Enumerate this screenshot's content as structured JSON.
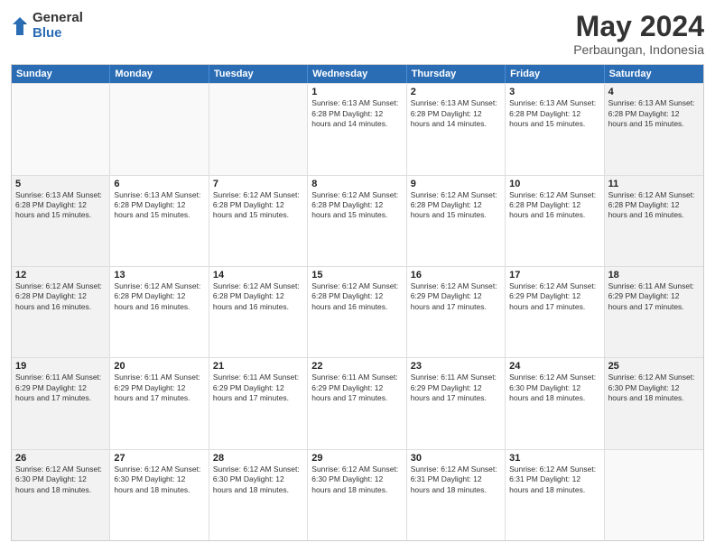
{
  "logo": {
    "general": "General",
    "blue": "Blue"
  },
  "title": "May 2024",
  "subtitle": "Perbaungan, Indonesia",
  "days": [
    "Sunday",
    "Monday",
    "Tuesday",
    "Wednesday",
    "Thursday",
    "Friday",
    "Saturday"
  ],
  "weeks": [
    [
      {
        "day": "",
        "text": "",
        "empty": true
      },
      {
        "day": "",
        "text": "",
        "empty": true
      },
      {
        "day": "",
        "text": "",
        "empty": true
      },
      {
        "day": "1",
        "text": "Sunrise: 6:13 AM\nSunset: 6:28 PM\nDaylight: 12 hours\nand 14 minutes.",
        "empty": false
      },
      {
        "day": "2",
        "text": "Sunrise: 6:13 AM\nSunset: 6:28 PM\nDaylight: 12 hours\nand 14 minutes.",
        "empty": false
      },
      {
        "day": "3",
        "text": "Sunrise: 6:13 AM\nSunset: 6:28 PM\nDaylight: 12 hours\nand 15 minutes.",
        "empty": false
      },
      {
        "day": "4",
        "text": "Sunrise: 6:13 AM\nSunset: 6:28 PM\nDaylight: 12 hours\nand 15 minutes.",
        "empty": false
      }
    ],
    [
      {
        "day": "5",
        "text": "Sunrise: 6:13 AM\nSunset: 6:28 PM\nDaylight: 12 hours\nand 15 minutes.",
        "empty": false
      },
      {
        "day": "6",
        "text": "Sunrise: 6:13 AM\nSunset: 6:28 PM\nDaylight: 12 hours\nand 15 minutes.",
        "empty": false
      },
      {
        "day": "7",
        "text": "Sunrise: 6:12 AM\nSunset: 6:28 PM\nDaylight: 12 hours\nand 15 minutes.",
        "empty": false
      },
      {
        "day": "8",
        "text": "Sunrise: 6:12 AM\nSunset: 6:28 PM\nDaylight: 12 hours\nand 15 minutes.",
        "empty": false
      },
      {
        "day": "9",
        "text": "Sunrise: 6:12 AM\nSunset: 6:28 PM\nDaylight: 12 hours\nand 15 minutes.",
        "empty": false
      },
      {
        "day": "10",
        "text": "Sunrise: 6:12 AM\nSunset: 6:28 PM\nDaylight: 12 hours\nand 16 minutes.",
        "empty": false
      },
      {
        "day": "11",
        "text": "Sunrise: 6:12 AM\nSunset: 6:28 PM\nDaylight: 12 hours\nand 16 minutes.",
        "empty": false
      }
    ],
    [
      {
        "day": "12",
        "text": "Sunrise: 6:12 AM\nSunset: 6:28 PM\nDaylight: 12 hours\nand 16 minutes.",
        "empty": false
      },
      {
        "day": "13",
        "text": "Sunrise: 6:12 AM\nSunset: 6:28 PM\nDaylight: 12 hours\nand 16 minutes.",
        "empty": false
      },
      {
        "day": "14",
        "text": "Sunrise: 6:12 AM\nSunset: 6:28 PM\nDaylight: 12 hours\nand 16 minutes.",
        "empty": false
      },
      {
        "day": "15",
        "text": "Sunrise: 6:12 AM\nSunset: 6:28 PM\nDaylight: 12 hours\nand 16 minutes.",
        "empty": false
      },
      {
        "day": "16",
        "text": "Sunrise: 6:12 AM\nSunset: 6:29 PM\nDaylight: 12 hours\nand 17 minutes.",
        "empty": false
      },
      {
        "day": "17",
        "text": "Sunrise: 6:12 AM\nSunset: 6:29 PM\nDaylight: 12 hours\nand 17 minutes.",
        "empty": false
      },
      {
        "day": "18",
        "text": "Sunrise: 6:11 AM\nSunset: 6:29 PM\nDaylight: 12 hours\nand 17 minutes.",
        "empty": false
      }
    ],
    [
      {
        "day": "19",
        "text": "Sunrise: 6:11 AM\nSunset: 6:29 PM\nDaylight: 12 hours\nand 17 minutes.",
        "empty": false
      },
      {
        "day": "20",
        "text": "Sunrise: 6:11 AM\nSunset: 6:29 PM\nDaylight: 12 hours\nand 17 minutes.",
        "empty": false
      },
      {
        "day": "21",
        "text": "Sunrise: 6:11 AM\nSunset: 6:29 PM\nDaylight: 12 hours\nand 17 minutes.",
        "empty": false
      },
      {
        "day": "22",
        "text": "Sunrise: 6:11 AM\nSunset: 6:29 PM\nDaylight: 12 hours\nand 17 minutes.",
        "empty": false
      },
      {
        "day": "23",
        "text": "Sunrise: 6:11 AM\nSunset: 6:29 PM\nDaylight: 12 hours\nand 17 minutes.",
        "empty": false
      },
      {
        "day": "24",
        "text": "Sunrise: 6:12 AM\nSunset: 6:30 PM\nDaylight: 12 hours\nand 18 minutes.",
        "empty": false
      },
      {
        "day": "25",
        "text": "Sunrise: 6:12 AM\nSunset: 6:30 PM\nDaylight: 12 hours\nand 18 minutes.",
        "empty": false
      }
    ],
    [
      {
        "day": "26",
        "text": "Sunrise: 6:12 AM\nSunset: 6:30 PM\nDaylight: 12 hours\nand 18 minutes.",
        "empty": false
      },
      {
        "day": "27",
        "text": "Sunrise: 6:12 AM\nSunset: 6:30 PM\nDaylight: 12 hours\nand 18 minutes.",
        "empty": false
      },
      {
        "day": "28",
        "text": "Sunrise: 6:12 AM\nSunset: 6:30 PM\nDaylight: 12 hours\nand 18 minutes.",
        "empty": false
      },
      {
        "day": "29",
        "text": "Sunrise: 6:12 AM\nSunset: 6:30 PM\nDaylight: 12 hours\nand 18 minutes.",
        "empty": false
      },
      {
        "day": "30",
        "text": "Sunrise: 6:12 AM\nSunset: 6:31 PM\nDaylight: 12 hours\nand 18 minutes.",
        "empty": false
      },
      {
        "day": "31",
        "text": "Sunrise: 6:12 AM\nSunset: 6:31 PM\nDaylight: 12 hours\nand 18 minutes.",
        "empty": false
      },
      {
        "day": "",
        "text": "",
        "empty": true
      }
    ]
  ]
}
